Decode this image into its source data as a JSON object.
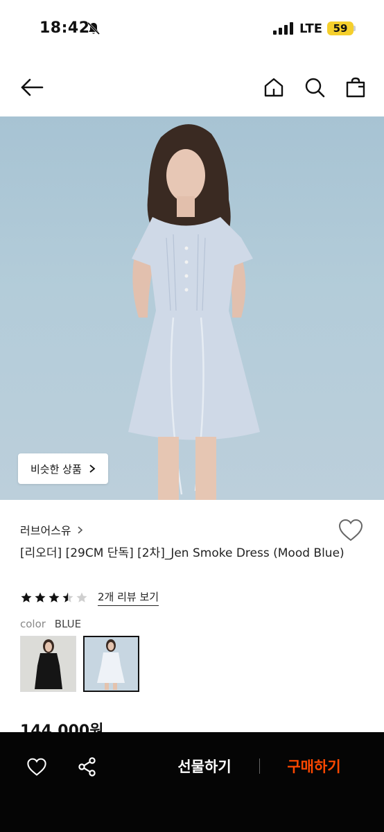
{
  "status_bar": {
    "time": "18:42",
    "network": "LTE",
    "battery": "59",
    "battery_color": "#f5cf2c"
  },
  "nav": {
    "back_icon": "arrow-left-icon",
    "home_icon": "home-icon",
    "search_icon": "search-icon",
    "cart_icon": "shopping-bag-icon"
  },
  "hero": {
    "similar_label": "비슷한 상품",
    "background": "#b3ccd9"
  },
  "product": {
    "brand": "러브어스유",
    "title": "[리오더] [29CM 단독] [2차]_Jen Smoke Dress (Mood Blue)",
    "rating": 3.5,
    "rating_max": 5,
    "review_link": "2개 리뷰 보기",
    "color_label": "color",
    "color_value": "BLUE",
    "swatches": [
      "black",
      "blue"
    ],
    "selected_swatch": "blue",
    "price": "144,000원"
  },
  "bottom_bar": {
    "gift_label": "선물하기",
    "buy_label": "구매하기",
    "buy_color": "#ff4800"
  }
}
